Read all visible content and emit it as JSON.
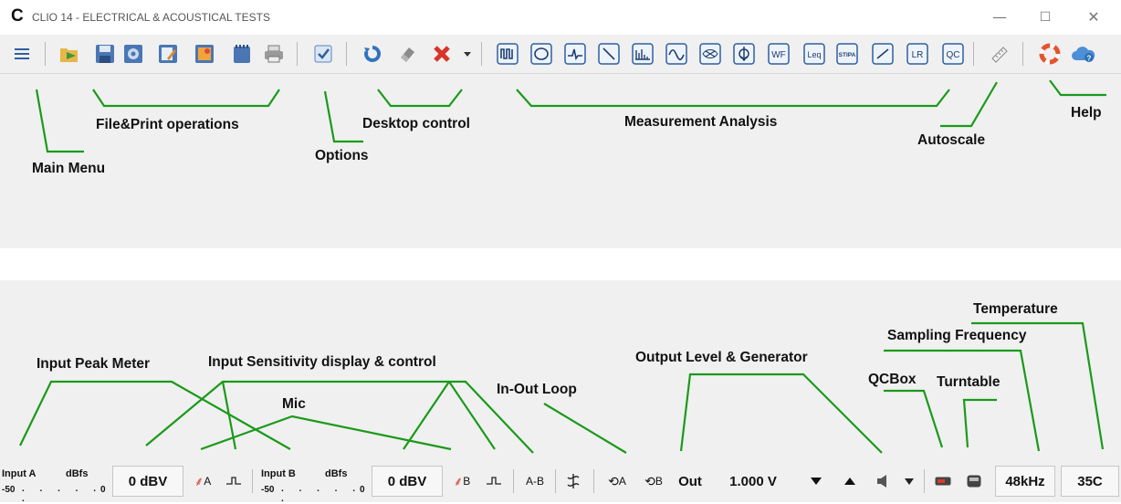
{
  "window": {
    "title": "CLIO 14 - ELECTRICAL & ACOUSTICAL TESTS",
    "logo_letter": "C",
    "minimize_glyph": "—",
    "maximize_glyph": "☐",
    "close_glyph": "✕"
  },
  "toolbar": {
    "icons": [
      "hamburger-menu-icon",
      "open-folder-icon",
      "save-icon",
      "export-icon",
      "edit-notes-icon",
      "image-export-icon",
      "clipboard-icon",
      "print-icon",
      "options-check-icon",
      "refresh-icon",
      "eraser-icon",
      "delete-x-icon",
      "dropdown-arrow-icon",
      "mls-icon",
      "sinusoid-icon",
      "fft-icon",
      "sweep-icon",
      "rta-icon",
      "waterfall-icon",
      "wow-flutter-icon",
      "thiele-icon",
      "wf-icon",
      "leq-icon",
      "stipa-icon",
      "linearity-icon",
      "lr-icon",
      "qc-icon",
      "autoscale-ruler-icon",
      "help-lifebuoy-icon",
      "cloud-help-icon"
    ],
    "measurement_labels": {
      "wf": "WF",
      "leq": "Leq",
      "stipa": "STIPA",
      "lr": "LR",
      "qc": "QC"
    }
  },
  "callouts": {
    "main_menu": "Main Menu",
    "file_print": "File&Print operations",
    "options": "Options",
    "desktop_control": "Desktop control",
    "measurement_analysis": "Measurement Analysis",
    "autoscale": "Autoscale",
    "help": "Help",
    "input_peak_meter": "Input Peak Meter",
    "input_sensitivity": "Input Sensitivity display & control",
    "mic": "Mic",
    "in_out_loop": "In-Out Loop",
    "output_level_generator": "Output Level & Generator",
    "qcbox": "QCBox",
    "turntable": "Turntable",
    "sampling_frequency": "Sampling Frequency",
    "temperature": "Temperature"
  },
  "statusbar": {
    "input_a_label": "Input A",
    "input_a_unit": "dBfs",
    "input_a_scale_min": "-50",
    "input_a_scale_max": "0",
    "input_a_sensitivity": "0 dBV",
    "mic_a": "A",
    "input_b_label": "Input B",
    "input_b_unit": "dBfs",
    "input_b_scale_min": "-50",
    "input_b_scale_max": "0",
    "input_b_sensitivity": "0 dBV",
    "mic_b": "B",
    "a_minus_b": "A-B",
    "loop_a": "A",
    "loop_b": "B",
    "out_label": "Out",
    "output_level": "1.000 V",
    "sampling_frequency": "48kHz",
    "temperature": "35C"
  }
}
